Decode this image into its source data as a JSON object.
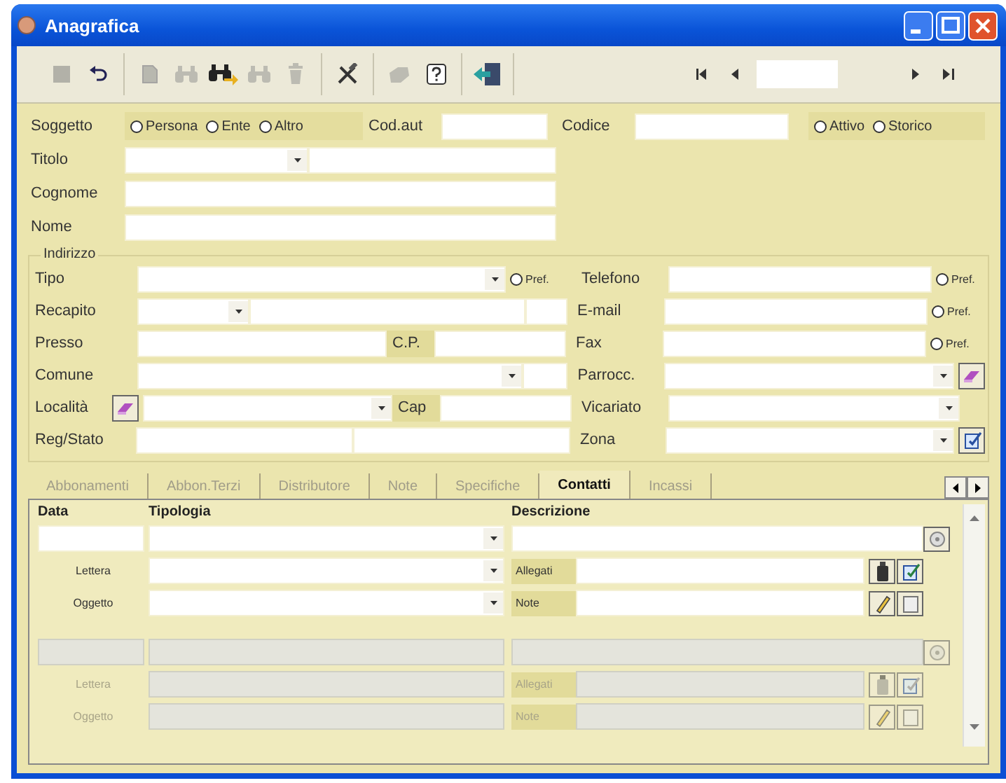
{
  "window": {
    "title": "Anagrafica"
  },
  "toolbar": {
    "groups": [
      {
        "buttons": [
          {
            "kind": "save",
            "disabled": true
          },
          {
            "kind": "undo",
            "disabled": false
          }
        ]
      },
      {
        "buttons": [
          {
            "kind": "new",
            "disabled": true
          },
          {
            "kind": "find",
            "disabled": true
          },
          {
            "kind": "find-next",
            "disabled": false
          },
          {
            "kind": "find",
            "disabled": true
          },
          {
            "kind": "delete",
            "disabled": true
          }
        ]
      },
      {
        "buttons": [
          {
            "kind": "tools",
            "disabled": false
          }
        ]
      },
      {
        "buttons": [
          {
            "kind": "print",
            "disabled": true
          },
          {
            "kind": "help",
            "disabled": false
          }
        ]
      },
      {
        "buttons": [
          {
            "kind": "exit",
            "disabled": false
          }
        ]
      }
    ],
    "navigator": [
      {
        "kind": "first"
      },
      {
        "kind": "prev"
      },
      {
        "kind": "field"
      },
      {
        "kind": "next"
      },
      {
        "kind": "last"
      }
    ]
  },
  "soggetto": {
    "label": "Soggetto",
    "types": [
      {
        "label": "Persona",
        "selected": false
      },
      {
        "label": "Ente",
        "selected": false
      },
      {
        "label": "Altro",
        "selected": false
      }
    ],
    "cod_aut": "Cod.aut",
    "codice": "Codice",
    "status": [
      {
        "label": "Attivo",
        "selected": false
      },
      {
        "label": "Storico",
        "selected": false
      }
    ]
  },
  "titolo": "Titolo",
  "cognome": "Cognome",
  "nome": "Nome",
  "indirizzo": {
    "title": "Indirizzo",
    "tipo": "Tipo",
    "recapito": "Recapito",
    "presso": "Presso",
    "cp": "C.P.",
    "comune": "Comune",
    "localita": "Località",
    "cap": "Cap",
    "reg_stato": "Reg/Stato",
    "tipo_pref": {
      "label": "Pref.",
      "selected": false
    },
    "contacts": [
      {
        "label": "Telefono",
        "pref": {
          "label": "Pref.",
          "selected": false
        }
      },
      {
        "label": "E-mail",
        "pref": {
          "label": "Pref.",
          "selected": false
        }
      },
      {
        "label": "Fax",
        "pref": {
          "label": "Pref.",
          "selected": false
        }
      }
    ],
    "parrocc": "Parrocc.",
    "vicariato": "Vicariato",
    "zona": "Zona"
  },
  "tabs": [
    {
      "label": "Abbonamenti",
      "selected": false
    },
    {
      "label": "Abbon.Terzi",
      "selected": false
    },
    {
      "label": "Distributore",
      "selected": false
    },
    {
      "label": "Note",
      "selected": false
    },
    {
      "label": "Specifiche",
      "selected": false
    },
    {
      "label": "Contatti",
      "selected": true
    },
    {
      "label": "Incassi",
      "selected": false
    }
  ],
  "contatti": {
    "columns": [
      "Data",
      "Tipologia",
      "Descrizione"
    ],
    "records": [
      {
        "disabled": false,
        "lettera": "Lettera",
        "allegati": "Allegati",
        "oggetto": "Oggetto",
        "note": "Note"
      },
      {
        "disabled": true,
        "lettera": "Lettera",
        "allegati": "Allegati",
        "oggetto": "Oggetto",
        "note": "Note"
      }
    ]
  }
}
